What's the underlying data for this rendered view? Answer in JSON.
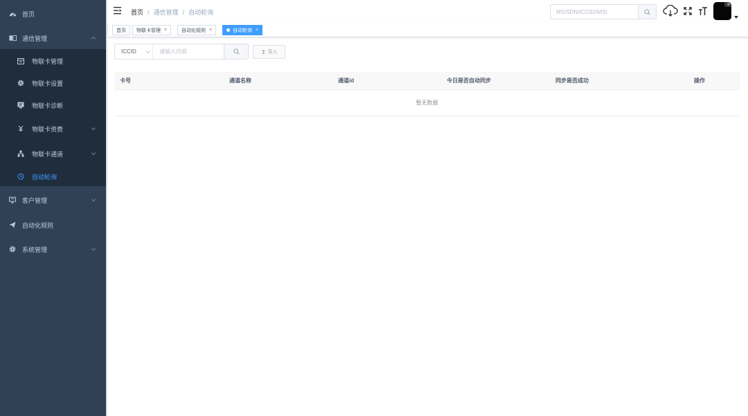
{
  "sidebar": {
    "items": [
      {
        "label": "首页",
        "icon": "dashboard-icon"
      },
      {
        "label": "通信管理",
        "icon": "book-icon"
      },
      {
        "label": "物联卡管理",
        "icon": "card-icon"
      },
      {
        "label": "物联卡设置",
        "icon": "gear-icon"
      },
      {
        "label": "物联卡诊断",
        "icon": "monitor-icon"
      },
      {
        "label": "物联卡资费",
        "icon": "tariff-icon"
      },
      {
        "label": "物联卡通道",
        "icon": "tree-icon"
      },
      {
        "label": "自动轮询",
        "icon": "clock-icon"
      },
      {
        "label": "客户管理",
        "icon": "screen-icon"
      },
      {
        "label": "自动化规则",
        "icon": "send-icon"
      },
      {
        "label": "系统管理",
        "icon": "gear-icon"
      }
    ],
    "active_label": "自动轮询",
    "colors": {
      "bg": "#304156",
      "submenu_bg": "#1f2d3d",
      "text": "#bfcbd9",
      "active": "#409eff"
    }
  },
  "navbar": {
    "breadcrumb": [
      "首页",
      "通信管理",
      "自动轮询"
    ],
    "breadcrumb_sep": "/",
    "search": {
      "placeholder": "MSISDN/ICCID/IMSI"
    },
    "tools": [
      "cloud-download-icon",
      "fullscreen-icon",
      "font-size-icon"
    ]
  },
  "tags": [
    {
      "label": "首页"
    },
    {
      "label": "物联卡管理",
      "close": "×"
    },
    {
      "label": "自动化规则",
      "close": "×"
    },
    {
      "label": "自动轮询",
      "close": "×",
      "active": true
    }
  ],
  "filter": {
    "select_value": "ICCID",
    "input_placeholder": "请输入内容",
    "import_label": "导入"
  },
  "table": {
    "columns": [
      "卡号",
      "通道名称",
      "通道id",
      "今日是否自动同步",
      "同步是否成功",
      "操作"
    ],
    "empty_text": "暂无数据"
  },
  "accent_color": "#409eff"
}
